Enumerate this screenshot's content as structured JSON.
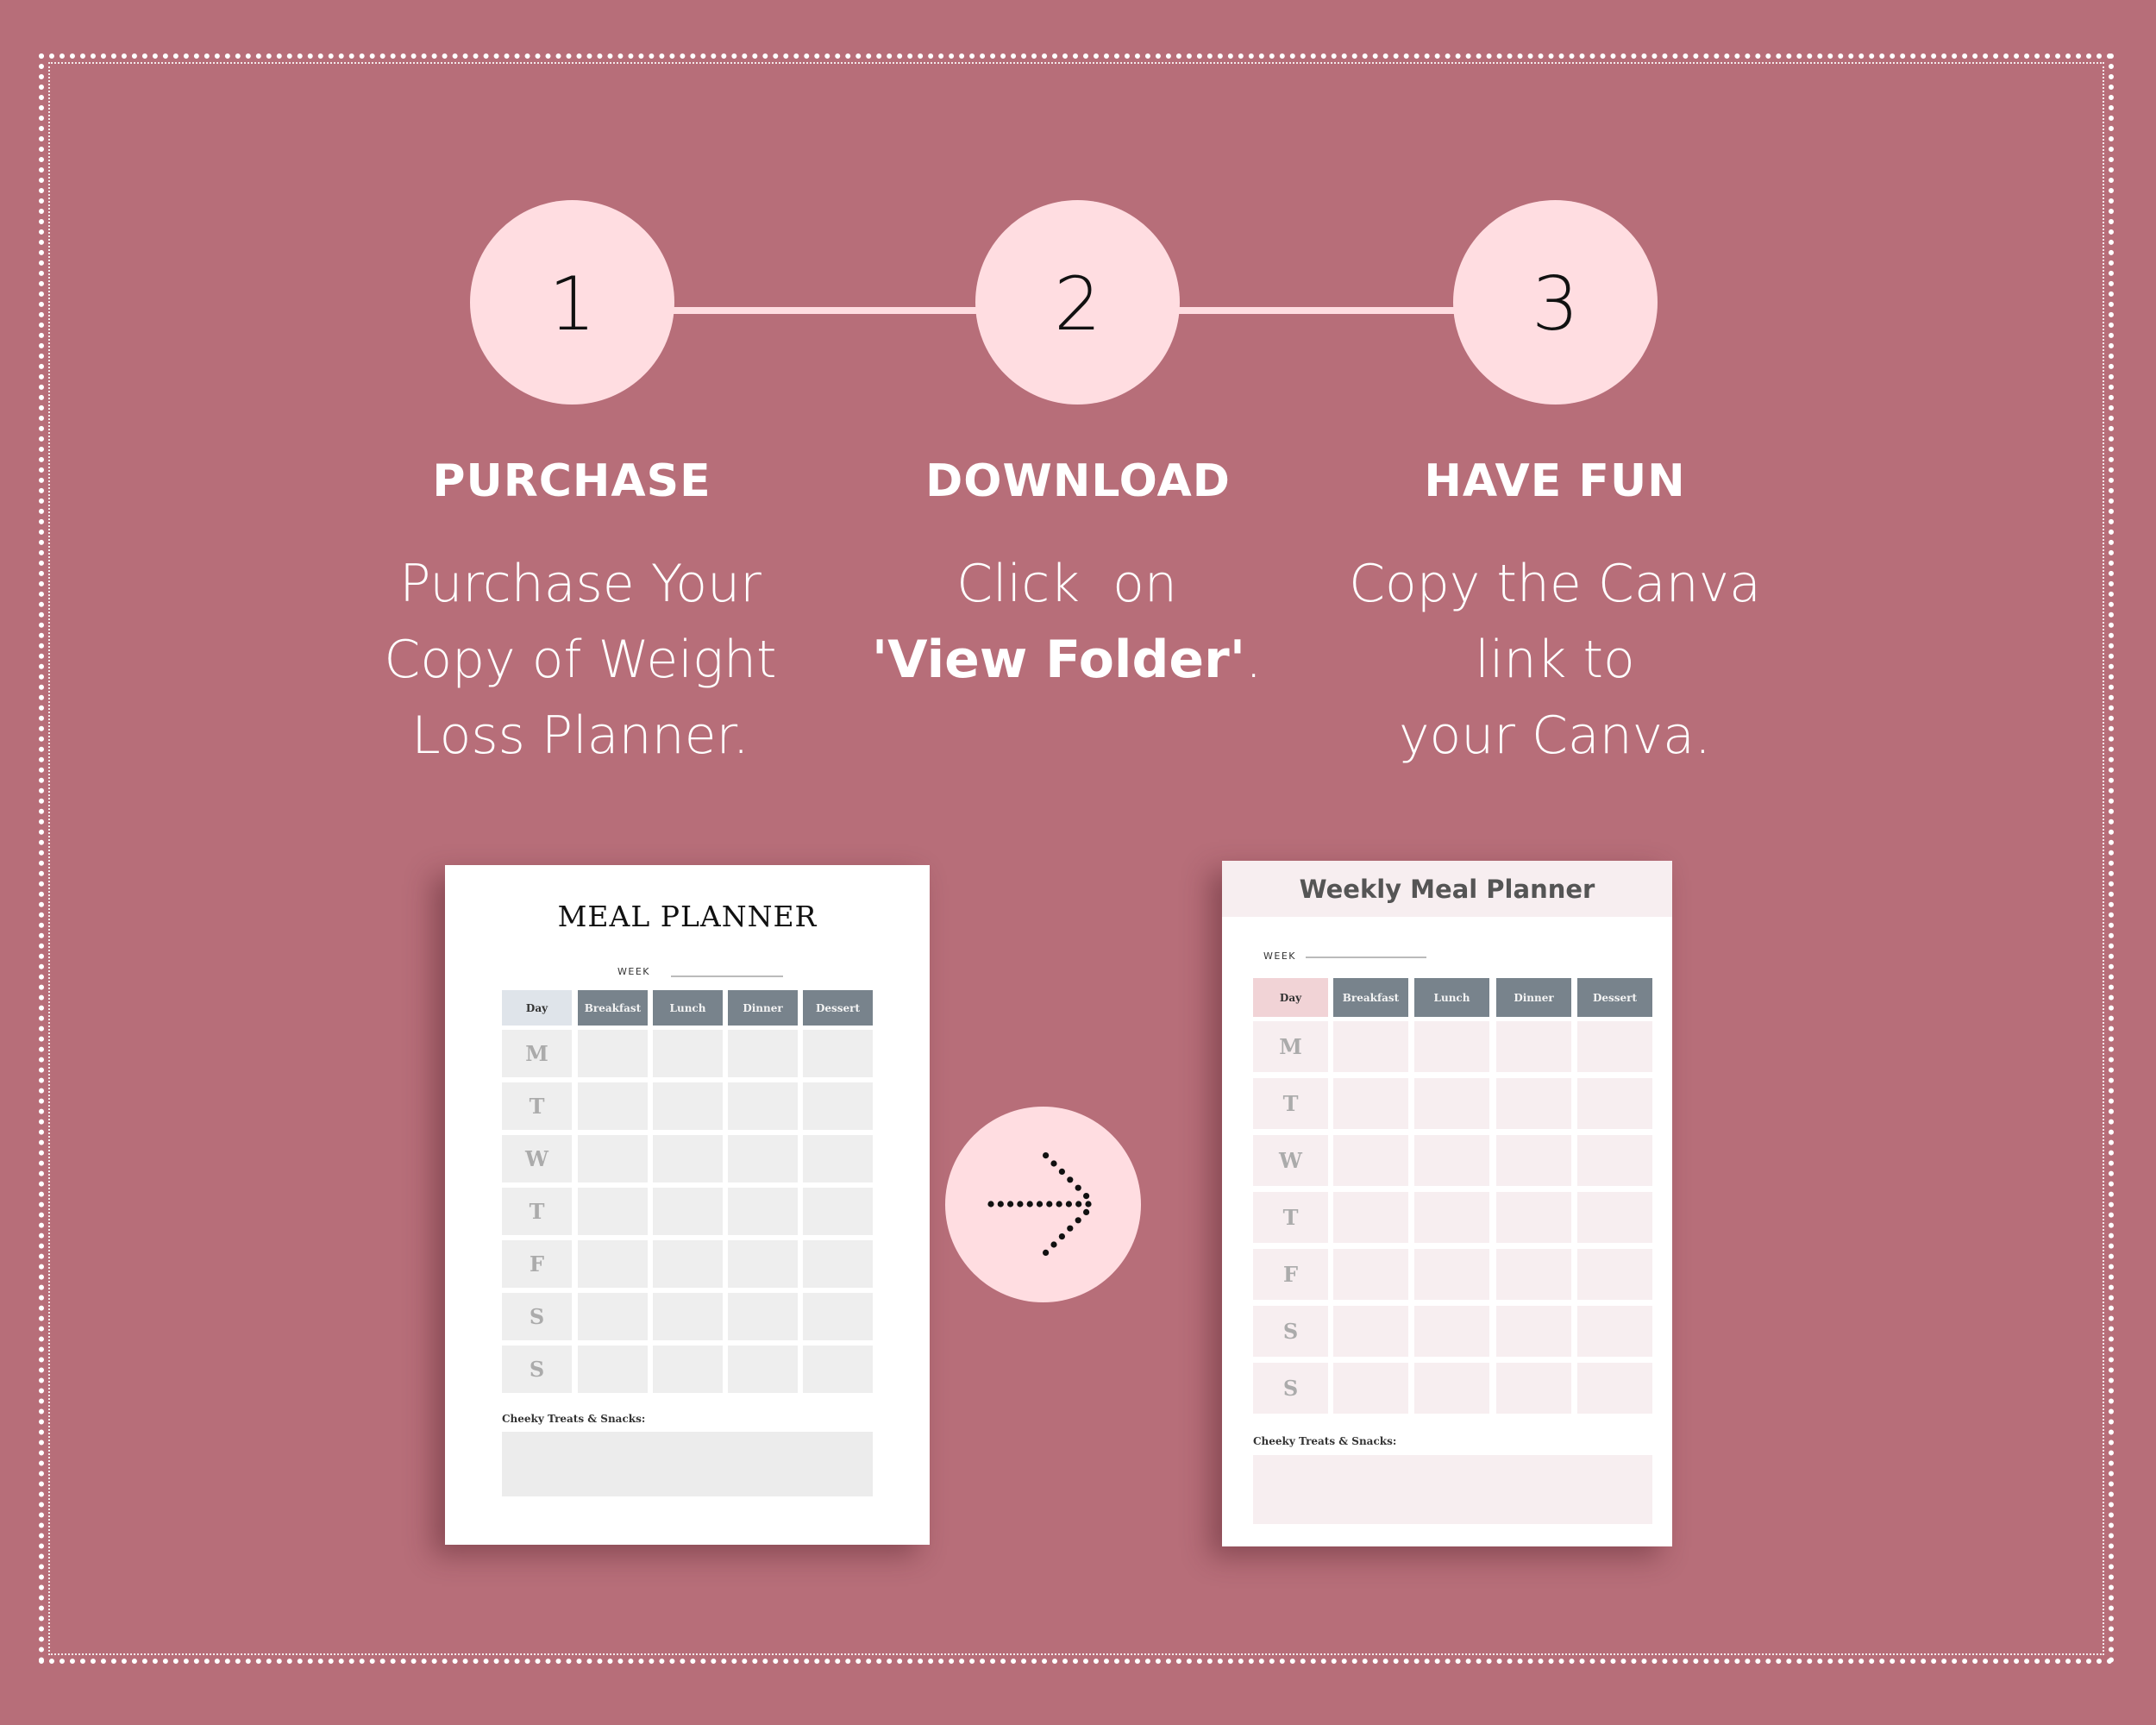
{
  "steps": [
    {
      "number": "1",
      "heading": "PURCHASE",
      "body_lines": [
        "Purchase Your",
        "Copy of Weight",
        "Loss Planner."
      ]
    },
    {
      "number": "2",
      "heading": "DOWNLOAD",
      "body_lines": [
        "Click  on"
      ],
      "body_bold": "'View Folder'",
      "body_after_bold": "."
    },
    {
      "number": "3",
      "heading": "HAVE FUN",
      "body_lines": [
        "Copy the Canva",
        "link to",
        "your Canva."
      ]
    }
  ],
  "colors": {
    "background": "#b76e79",
    "circle": "#ffdde1",
    "header_cell": "#78838c"
  },
  "planner_before": {
    "title": "MEAL PLANNER",
    "week_label": "WEEK",
    "columns": [
      "Day",
      "Breakfast",
      "Lunch",
      "Dinner",
      "Dessert"
    ],
    "days": [
      "M",
      "T",
      "W",
      "T",
      "F",
      "S",
      "S"
    ],
    "snacks_label": "Cheeky Treats & Snacks:"
  },
  "planner_after": {
    "title": "Weekly Meal Planner",
    "week_label": "WEEK",
    "columns": [
      "Day",
      "Breakfast",
      "Lunch",
      "Dinner",
      "Dessert"
    ],
    "days": [
      "M",
      "T",
      "W",
      "T",
      "F",
      "S",
      "S"
    ],
    "snacks_label": "Cheeky Treats & Snacks:"
  },
  "icons": {
    "transform_arrow": "dotted-arrow-right-icon"
  }
}
